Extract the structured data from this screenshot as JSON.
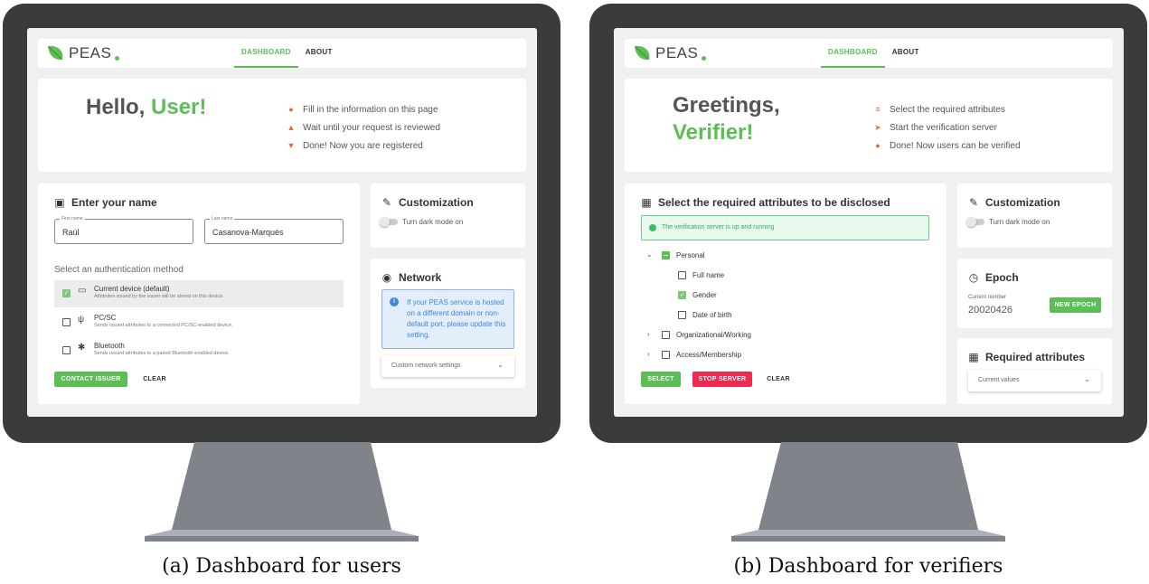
{
  "app": {
    "name": "PEAS"
  },
  "colors": {
    "accent": "#5cbf55",
    "danger": "#f0294e",
    "info": "#3c86e0",
    "frame": "#3b3b3b"
  },
  "nav": {
    "dashboard": "DASHBOARD",
    "about": "ABOUT"
  },
  "left": {
    "hero": {
      "greeting": "Hello, ",
      "name": "User!",
      "steps": [
        "Fill in the information on this page",
        "Wait until your request is reviewed",
        "Done! Now you are registered"
      ]
    },
    "name_card": {
      "title": "Enter your name",
      "first_name_label": "First name",
      "first_name_value": "Raúl",
      "last_name_label": "Last name",
      "last_name_value": "Casanova-Marqués",
      "auth_label": "Select an authentication method",
      "auth_options": [
        {
          "title": "Current device (default)",
          "desc": "Attributes issued by the issuer will be stored on this device."
        },
        {
          "title": "PC/SC",
          "desc": "Sends issued attributes to a connected PC/SC-enabled device."
        },
        {
          "title": "Bluetooth",
          "desc": "Sends issued attributes to a paired Bluetooth-enabled device."
        }
      ],
      "contact_button": "CONTACT ISSUER",
      "clear_button": "CLEAR"
    },
    "customization": {
      "title": "Customization",
      "toggle_label": "Turn dark mode on"
    },
    "network": {
      "title": "Network",
      "info": "If your PEAS service is hosted on a different domain or non-default port, please update this setting.",
      "select_label": "Custom network settings"
    }
  },
  "right": {
    "hero": {
      "greeting": "Greetings,",
      "name": "Verifier!",
      "steps": [
        "Select the required attributes",
        "Start the verification server",
        "Done! Now users can be verified"
      ]
    },
    "attributes_card": {
      "title": "Select the required attributes to be disclosed",
      "status": "The verification server is up and running",
      "tree": {
        "personal": "Personal",
        "full_name": "Full name",
        "gender": "Gender",
        "date_of_birth": "Date of birth",
        "organizational": "Organizational/Working",
        "access": "Access/Membership"
      },
      "select_button": "SELECT",
      "stop_button": "STOP SERVER",
      "clear_button": "CLEAR"
    },
    "customization": {
      "title": "Customization",
      "toggle_label": "Turn dark mode on"
    },
    "epoch": {
      "title": "Epoch",
      "label": "Current number",
      "value": "20020426",
      "button": "NEW EPOCH"
    },
    "required": {
      "title": "Required attributes",
      "select_label": "Current values"
    }
  },
  "captions": {
    "left": "(a) Dashboard for users",
    "right": "(b) Dashboard for verifiers"
  }
}
